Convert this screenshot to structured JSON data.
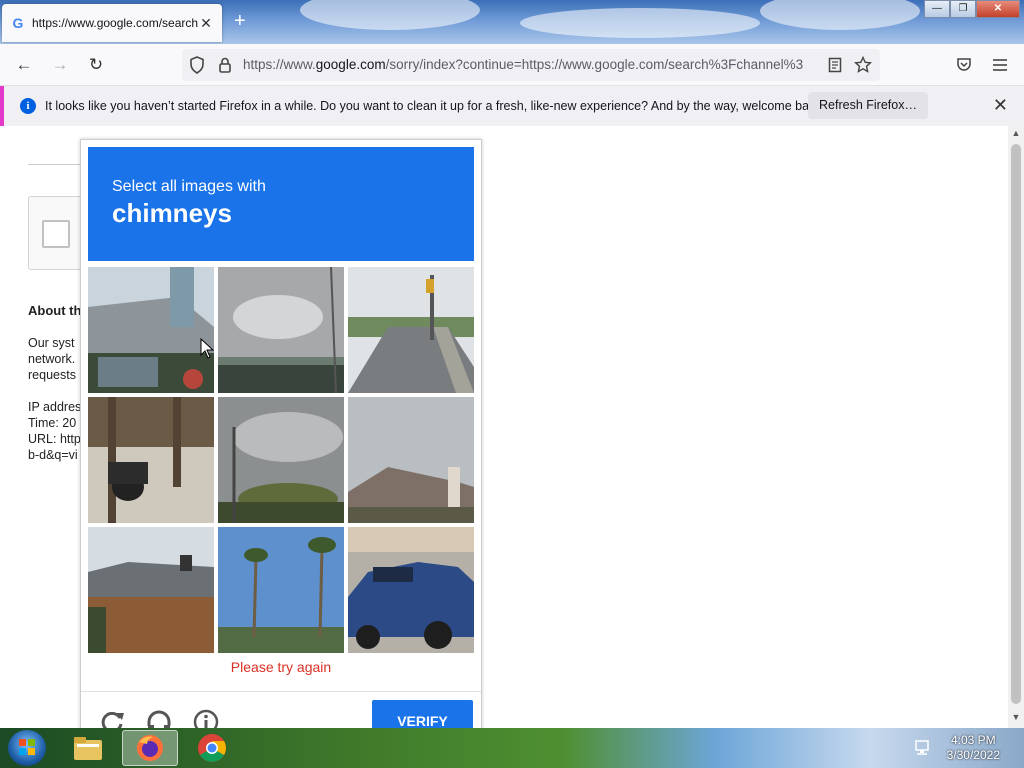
{
  "browser": {
    "tab": {
      "title": "https://www.google.com/search",
      "favicon": "G",
      "close": "✕"
    },
    "new_tab": "+",
    "window_buttons": {
      "minimize": "—",
      "restore": "❐",
      "close": "✕"
    },
    "toolbar": {
      "back": "←",
      "forward": "→",
      "reload": "↻",
      "url_prefix": "https://www.",
      "url_domain": "google.com",
      "url_rest": "/sorry/index?continue=https://www.google.com/search%3Fchannel%3",
      "reader_icon": "reader-view-icon",
      "bookmark_icon": "star-icon",
      "pocket_icon": "pocket-icon",
      "menu_icon": "hamburger-menu-icon"
    },
    "notification": {
      "message": "It looks like you haven’t started Firefox in a while. Do you want to clean it up for a fresh, like-new experience? And by the way, welcome back!",
      "button": "Refresh Firefox…",
      "close": "✕"
    }
  },
  "page": {
    "about_heading": "About th",
    "para1": [
      "Our syst",
      "network.",
      "requests"
    ],
    "para2": [
      "IP addres",
      "Time: 20",
      "URL: http",
      "b-d&q=vi"
    ]
  },
  "captcha": {
    "instruction": "Select all images with",
    "target": "chimneys",
    "tiles": [
      "house-with-chimney",
      "cloudy-sky-overpass",
      "street-with-traffic-light",
      "motorcycle-on-sidewalk",
      "cloudy-sky-trees",
      "house-with-chimney-2",
      "roof-with-chimney-fence",
      "palm-trees",
      "blue-pickup-truck"
    ],
    "error": "Please try again",
    "reload_icon": "reload-icon",
    "audio_icon": "headphones-icon",
    "info_icon": "info-icon",
    "verify": "VERIFY",
    "accent_color": "#1a73e8",
    "error_color": "#d93025"
  },
  "taskbar": {
    "apps": [
      "explorer",
      "firefox",
      "chrome"
    ],
    "time": "4:03 PM",
    "date": "3/30/2022"
  }
}
